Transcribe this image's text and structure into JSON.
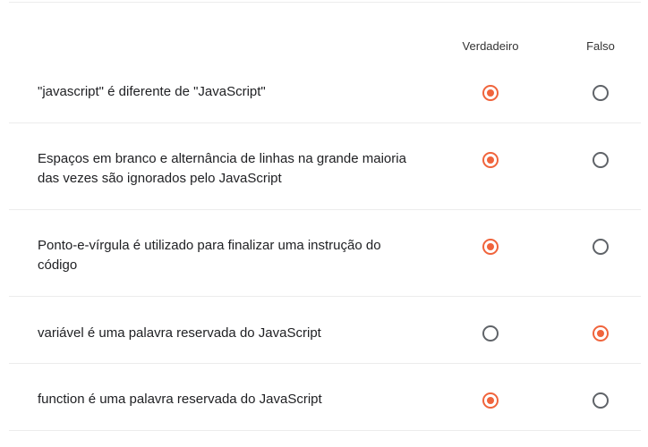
{
  "columns": {
    "true_label": "Verdadeiro",
    "false_label": "Falso"
  },
  "accent_color": "#f0643c",
  "questions": [
    {
      "text": "\"javascript\" é diferente de \"JavaScript\"",
      "answer": "Verdadeiro"
    },
    {
      "text": "Espaços em branco e alternância de linhas na grande maioria das vezes são ignorados pelo JavaScript",
      "answer": "Verdadeiro"
    },
    {
      "text": "Ponto-e-vírgula é utilizado para finalizar uma instrução do código",
      "answer": "Verdadeiro"
    },
    {
      "text": "variável é uma palavra reservada do JavaScript",
      "answer": "Falso"
    },
    {
      "text": "function é uma palavra reservada do JavaScript",
      "answer": "Verdadeiro"
    }
  ]
}
